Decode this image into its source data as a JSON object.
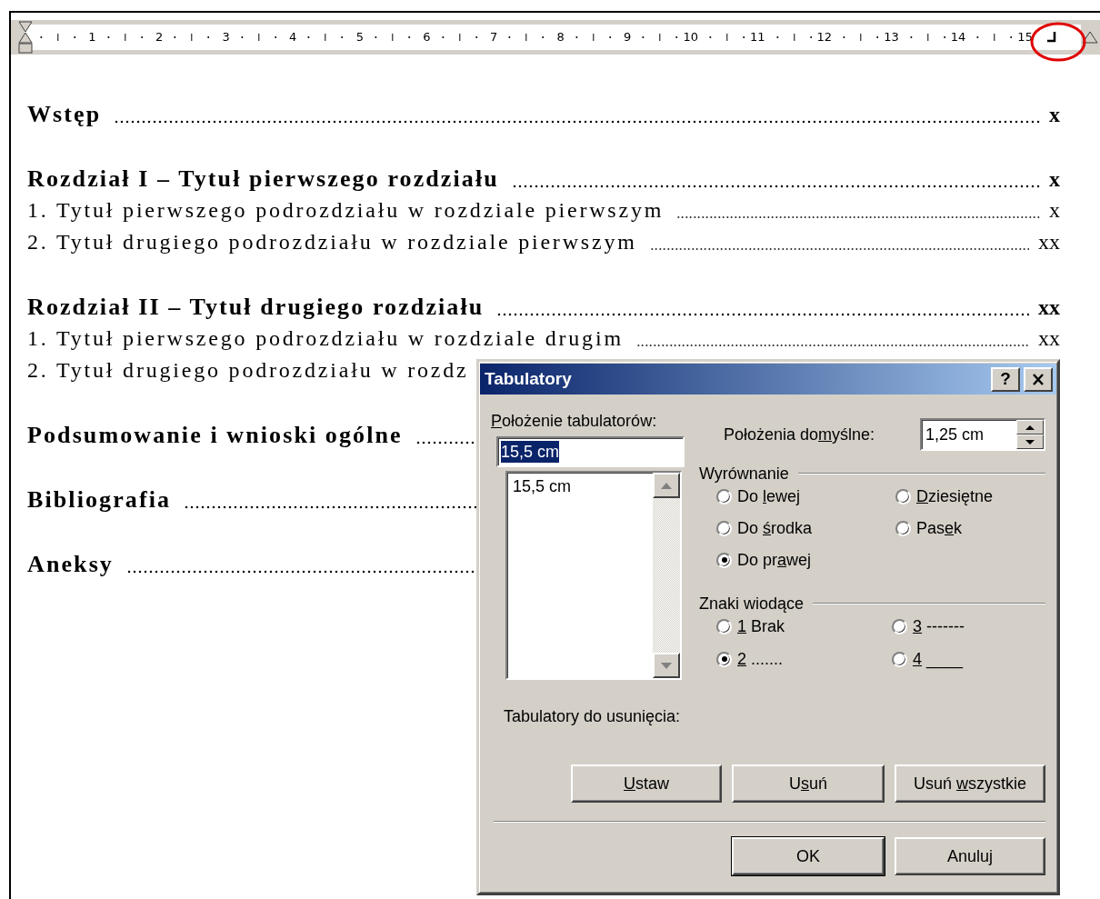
{
  "ruler": {
    "numbers": [
      "1",
      "2",
      "3",
      "4",
      "5",
      "6",
      "7",
      "8",
      "9",
      "10",
      "11",
      "12",
      "13",
      "14",
      "15"
    ]
  },
  "toc": [
    {
      "kind": "chapter",
      "title": "Wstęp",
      "page": "x"
    },
    {
      "kind": "chapter",
      "title": "Rozdział I – Tytuł pierwszego rozdziału",
      "page": "x",
      "children": [
        {
          "kind": "section",
          "title": "1. Tytuł pierwszego podrozdziału w rozdziale pierwszym",
          "page": "x"
        },
        {
          "kind": "section",
          "title": "2. Tytuł drugiego podrozdziału w rozdziale pierwszym",
          "page": "xx"
        }
      ]
    },
    {
      "kind": "chapter",
      "title": "Rozdział II – Tytuł drugiego rozdziału",
      "page": "xx",
      "children": [
        {
          "kind": "section",
          "title": "1. Tytuł pierwszego podrozdziału w rozdziale drugim",
          "page": "xx"
        },
        {
          "kind": "section",
          "title": "2. Tytuł drugiego podrozdziału w rozdz"
        }
      ]
    },
    {
      "kind": "chapter",
      "title": "Podsumowanie i wnioski ogólne"
    },
    {
      "kind": "chapter",
      "title": "Bibliografia"
    },
    {
      "kind": "chapter",
      "title": "Aneksy"
    }
  ],
  "dialog": {
    "title": "Tabulatory",
    "help": "?",
    "tab_position": {
      "label": "Położenie tabulatorów:",
      "value": "15,5 cm"
    },
    "tab_list": {
      "items": [
        {
          "label": "15,5 cm",
          "selected": false
        }
      ]
    },
    "default_positions": {
      "label": "Położenia domyślne:",
      "value": "1,25 cm"
    },
    "alignment": {
      "label": "Wyrównanie",
      "options": [
        {
          "label": "Do lewej",
          "selected": false
        },
        {
          "label": "Dziesiętne",
          "selected": false
        },
        {
          "label": "Do środka",
          "selected": false
        },
        {
          "label": "Pasek",
          "selected": false
        },
        {
          "label": "Do prawej",
          "selected": true
        }
      ]
    },
    "leaders": {
      "label": "Znaki wiodące",
      "options": [
        {
          "label": "1 Brak",
          "selected": false
        },
        {
          "label": "3 -------",
          "selected": false
        },
        {
          "label": "2 .......",
          "selected": true
        },
        {
          "label": "4 ____",
          "selected": false
        }
      ]
    },
    "to_clear": {
      "label": "Tabulatory do usunięcia:"
    },
    "buttons": [
      {
        "label": "Ustaw"
      },
      {
        "label": "Usuń"
      },
      {
        "label": "Usuń wszystkie"
      }
    ],
    "footer_buttons": [
      {
        "label": "OK",
        "default": true
      },
      {
        "label": "Anuluj",
        "default": false
      }
    ]
  }
}
